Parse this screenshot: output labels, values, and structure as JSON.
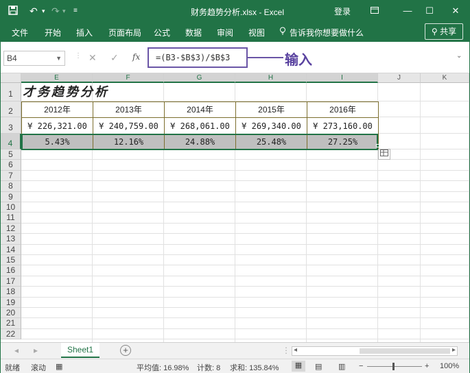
{
  "window": {
    "title": "财务趋势分析.xlsx - Excel",
    "login": "登录",
    "quick_access": [
      "save-icon",
      "undo-icon",
      "redo-icon",
      "customize-icon"
    ]
  },
  "ribbon": {
    "tabs": [
      "文件",
      "开始",
      "插入",
      "页面布局",
      "公式",
      "数据",
      "审阅",
      "视图"
    ],
    "tell_me": "告诉我你想要做什么",
    "share": "共享"
  },
  "formula_bar": {
    "name_box": "B4",
    "formula": "=(B3-$B$3)/$B$3",
    "fx": "fx",
    "callout": "输入"
  },
  "grid": {
    "columns": [
      "E",
      "F",
      "G",
      "H",
      "I",
      "J",
      "K"
    ],
    "rows": [
      "1",
      "2",
      "3",
      "4",
      "5",
      "6",
      "7",
      "8",
      "9",
      "10",
      "11",
      "12",
      "13",
      "14",
      "15",
      "16",
      "17",
      "18",
      "19",
      "20",
      "21",
      "22"
    ],
    "title_cell": "才务趋势分析",
    "years": [
      "2012年",
      "2013年",
      "2014年",
      "2015年",
      "2016年"
    ],
    "amounts": [
      "¥ 226,321.00",
      "¥ 240,759.00",
      "¥ 268,061.00",
      "¥ 269,340.00",
      "¥ 273,160.00"
    ],
    "percents": [
      "5.43%",
      "12.16%",
      "24.88%",
      "25.48%",
      "27.25%"
    ]
  },
  "sheets": {
    "active": "Sheet1"
  },
  "status": {
    "ready": "就绪",
    "scroll": "滚动",
    "average": "平均值: 16.98%",
    "count": "计数: 8",
    "sum": "求和: 135.84%",
    "zoom": "100%"
  },
  "colors": {
    "accent": "#217346",
    "callout": "#6a55a6",
    "selected_row_fill": "#bfbfbf",
    "table_border": "#7c6e2d"
  }
}
